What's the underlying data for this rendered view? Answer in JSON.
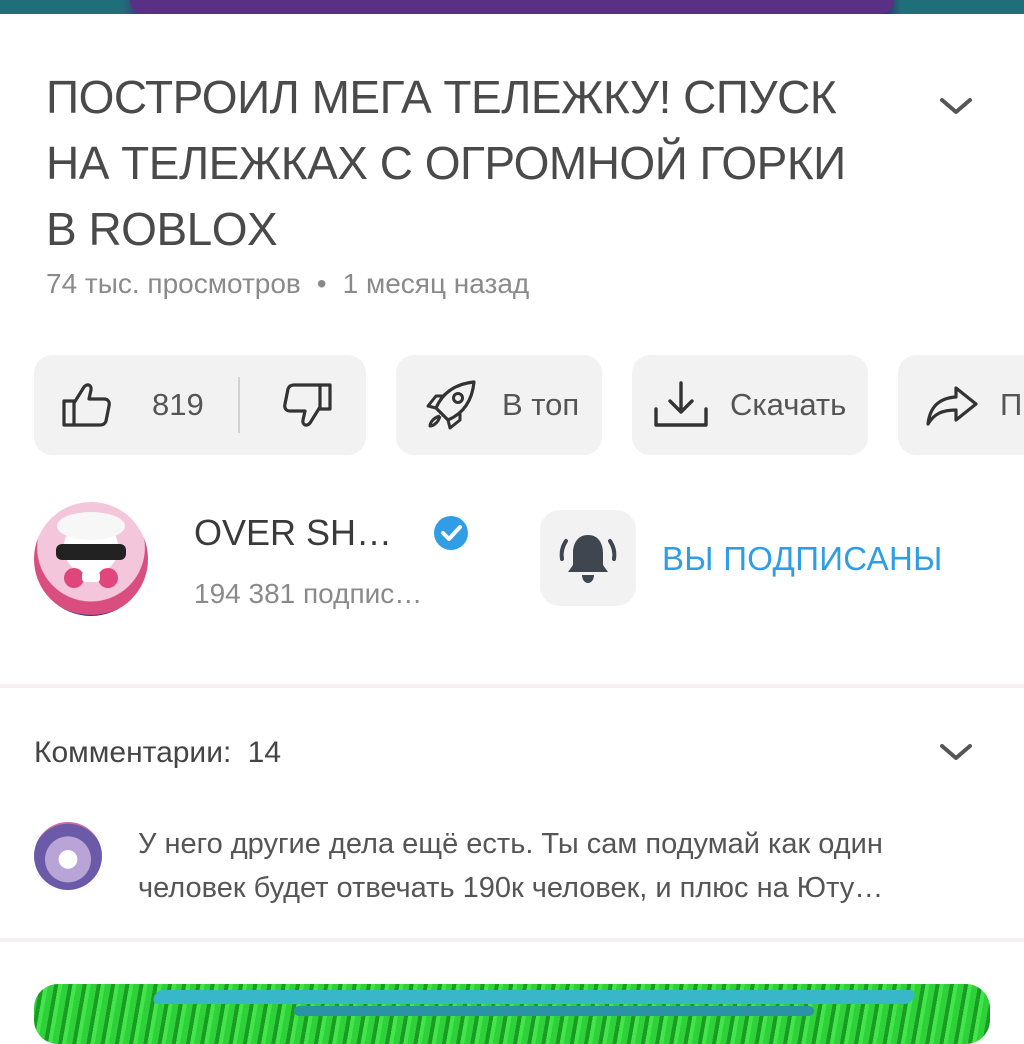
{
  "video": {
    "title": "ПОСТРОИЛ МЕГА ТЕЛЕЖКУ! СПУСК НА ТЕЛЕЖКАХ С ОГРОМНОЙ ГОРКИ В ROBLOX",
    "views": "74 тыс. просмотров",
    "separator": "•",
    "age": "1 месяц назад",
    "expand_icon": "chevron-down-icon"
  },
  "actions": {
    "like_count": "819",
    "promote_label": "В топ",
    "download_label": "Скачать",
    "share_label": "П",
    "icons": [
      "thumb-up-icon",
      "thumb-down-icon",
      "rocket-icon",
      "download-icon",
      "share-icon"
    ]
  },
  "channel": {
    "name": "OVER SH…",
    "subscribers": "194 381 подпис…",
    "subscribed_label": "ВЫ ПОДПИСАНЫ",
    "verified_icon": "verified-icon",
    "bell_icon": "bell-icon"
  },
  "comments": {
    "header_label": "Комментарии:",
    "count": "14",
    "expand_icon": "chevron-down-icon",
    "top_comment": "У него другие дела ещё есть. Ты сам подумай как один человек будет отвечать 190к человек, и плюс на Юту…"
  },
  "colors": {
    "accent_blue": "#2f9ee6",
    "pill_bg": "#f2f2f2",
    "text_gray": "#8a8a8a"
  }
}
